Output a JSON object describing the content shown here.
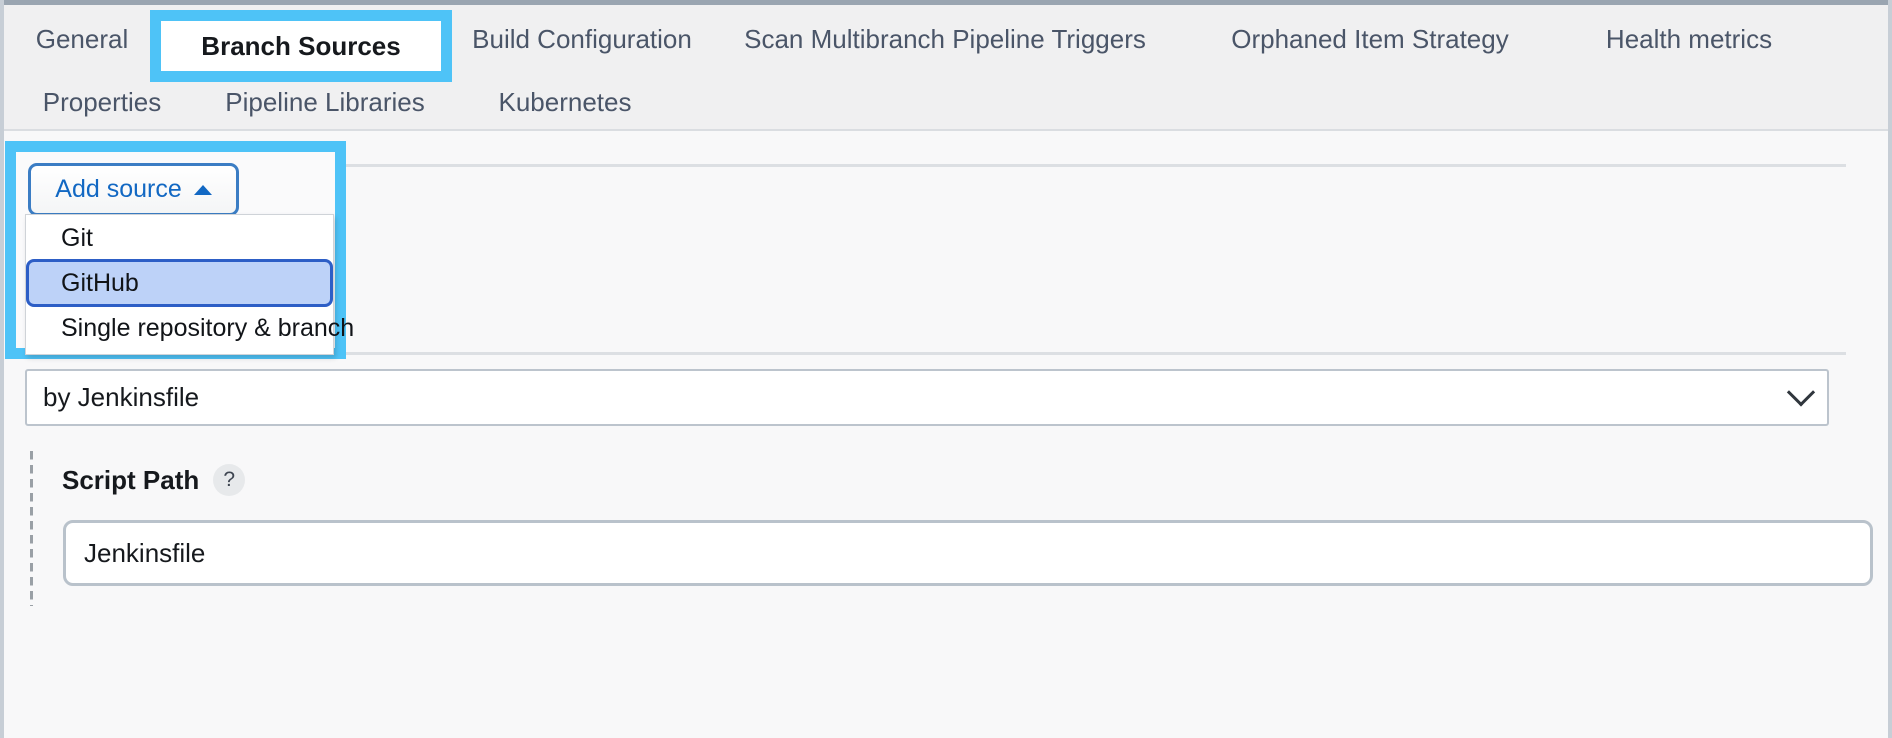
{
  "tabs": {
    "row1": [
      {
        "label": "General",
        "active": false
      },
      {
        "label": "Branch Sources",
        "active": true
      },
      {
        "label": "Build Configuration",
        "active": false
      },
      {
        "label": "Scan Multibranch Pipeline Triggers",
        "active": false
      },
      {
        "label": "Orphaned Item Strategy",
        "active": false
      },
      {
        "label": "Health metrics",
        "active": false
      }
    ],
    "row2": [
      {
        "label": "Properties",
        "active": false
      },
      {
        "label": "Pipeline Libraries",
        "active": false
      },
      {
        "label": "Kubernetes",
        "active": false
      }
    ]
  },
  "branch_sources": {
    "add_source": {
      "label": "Add source",
      "caret_icon": "caret-up-icon",
      "expanded": true,
      "options": [
        {
          "label": "Git",
          "selected": false
        },
        {
          "label": "GitHub",
          "selected": true
        },
        {
          "label": "Single repository & branch",
          "selected": false
        }
      ]
    }
  },
  "build_configuration": {
    "mode_select": {
      "value": "by Jenkinsfile",
      "chevron_icon": "chevron-down-icon"
    },
    "script_path": {
      "label": "Script Path",
      "help_icon": "help-question-icon",
      "help_glyph": "?",
      "value": "Jenkinsfile",
      "placeholder": "Jenkinsfile"
    }
  },
  "highlights": {
    "color": "#4ec3f7",
    "targets": [
      "Branch Sources",
      "Add source"
    ]
  },
  "colors": {
    "accent_link": "#1268c3",
    "selected_bg": "#bdd2f8",
    "selected_border": "#2d5ec6",
    "tabbar_bg": "#f0f0f1",
    "body_bg": "#f8f8f9"
  }
}
